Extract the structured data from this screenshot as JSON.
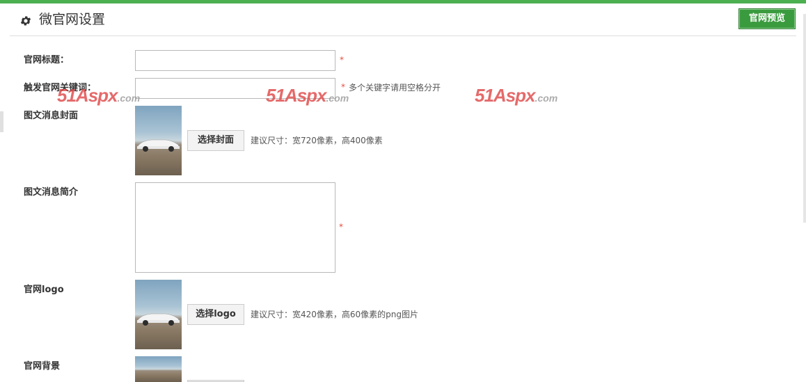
{
  "header": {
    "title": "微官网设置",
    "icon": "gear-icon",
    "preview_button": "官网预览"
  },
  "colors": {
    "accent": "#4caf50",
    "button_green": "#3a9b3e",
    "required": "#e74c3c",
    "watermark": "#e04a4a"
  },
  "form": {
    "site_title": {
      "label": "官网标题：",
      "value": "",
      "required_mark": "*"
    },
    "trigger_keywords": {
      "label": "触发官网关键词：",
      "value": "",
      "required_mark": "*",
      "hint": "多个关键字请用空格分开"
    },
    "cover": {
      "label": "图文消息封面",
      "button": "选择封面",
      "hint": "建议尺寸：宽720像素，高400像素"
    },
    "summary": {
      "label": "图文消息简介",
      "value": "",
      "required_mark": "*"
    },
    "logo": {
      "label": "官网logo",
      "button": "选择logo",
      "hint": "建议尺寸：宽420像素，高60像素的png图片"
    },
    "background": {
      "label": "官网背景"
    }
  },
  "watermarks": [
    {
      "brand": "51Aspx",
      "domain": ".com"
    },
    {
      "brand": "51Aspx",
      "domain": ".com"
    },
    {
      "brand": "51Aspx",
      "domain": ".com"
    }
  ]
}
